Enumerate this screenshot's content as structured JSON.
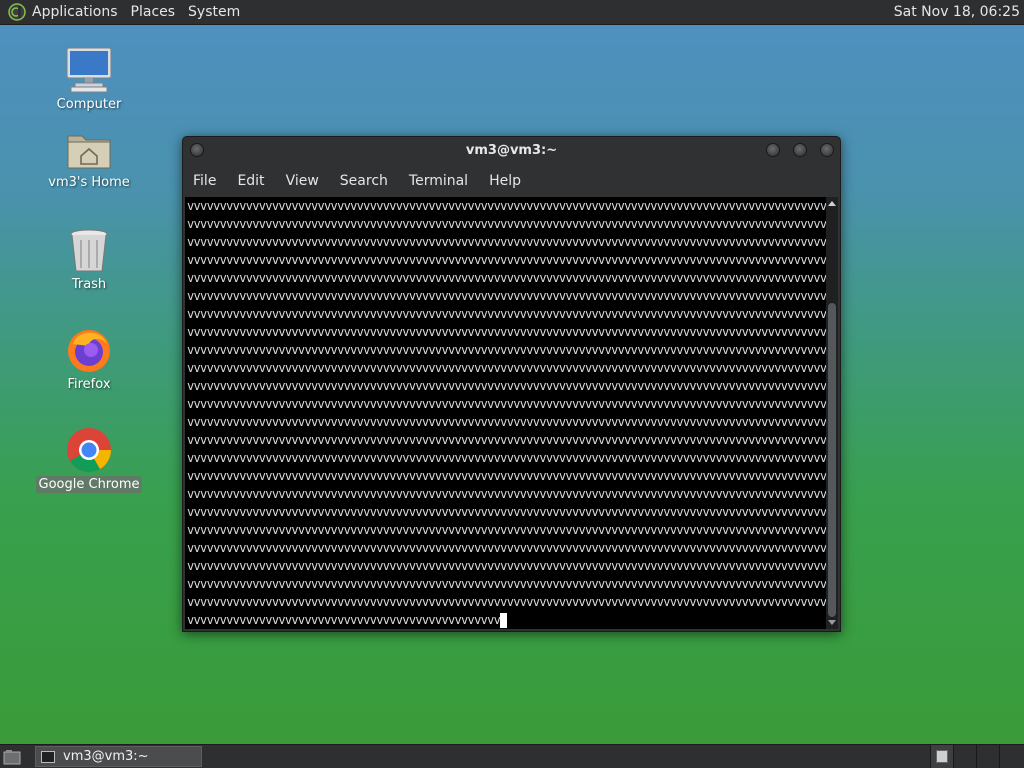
{
  "top_panel": {
    "menu": [
      "Applications",
      "Places",
      "System"
    ],
    "clock": "Sat Nov 18, 06:25"
  },
  "desktop": {
    "icons": [
      {
        "label": "Computer",
        "icon": "computer-icon"
      },
      {
        "label": "vm3's Home",
        "icon": "home-folder-icon"
      },
      {
        "label": "Trash",
        "icon": "trash-icon"
      },
      {
        "label": "Firefox",
        "icon": "firefox-icon"
      },
      {
        "label": "Google Chrome",
        "icon": "chrome-icon",
        "selected": true
      }
    ]
  },
  "terminal": {
    "title": "vm3@vm3:~",
    "menu": [
      "File",
      "Edit",
      "View",
      "Search",
      "Terminal",
      "Help"
    ],
    "lines": [
      "vvvvvvvvvvvvvvvvvvvvvvvvvvvvvvvvvvvvvvvvvvvvvvvvvvvvvvvvvvvvvvvvvvvvvvvvvvvvvvvvvvvvvvvvvvvvvvvvvvvvvv",
      "vvvvvvvvvvvvvvvvvvvvvvvvvvvvvvvvvvvvvvvvvvvvvvvvvvvvvvvvvvvvvvvvvvvvvvvvvvvvvvvvvvvvvvvvvvvvvvvvvvvvvv",
      "vvvvvvvvvvvvvvvvvvvvvvvvvvvvvvvvvvvvvvvvvvvvvvvvvvvvvvvvvvvvvvvvvvvvvvvvvvvvvvvvvvvvvvvvvvvvvvvvvvvvvv",
      "vvvvvvvvvvvvvvvvvvvvvvvvvvvvvvvvvvvvvvvvvvvvvvvvvvvvvvvvvvvvvvvvvvvvvvvvvvvvvvvvvvvvvvvvvvvvvvvvvvvvvv",
      "vvvvvvvvvvvvvvvvvvvvvvvvvvvvvvvvvvvvvvvvvvvvvvvvvvvvvvvvvvvvvvvvvvvvvvvvvvvvvvvvvvvvvvvvvvvvvvvvvvvvvv",
      "vvvvvvvvvvvvvvvvvvvvvvvvvvvvvvvvvvvvvvvvvvvvvvvvvvvvvvvvvvvvvvvvvvvvvvvvvvvvvvvvvvvvvvvvvvvvvvvvvvvvvv",
      "vvvvvvvvvvvvvvvvvvvvvvvvvvvvvvvvvvvvvvvvvvvvvvvvvvvvvvvvvvvvvvvvvvvvvvvvvvvvvvvvvvvvvvvvvvvvvvvvvvvvvv",
      "vvvvvvvvvvvvvvvvvvvvvvvvvvvvvvvvvvvvvvvvvvvvvvvvvvvvvvvvvvvvvvvvvvvvvvvvvvvvvvvvvvvvvvvvvvvvvvvvvvvvvv",
      "vvvvvvvvvvvvvvvvvvvvvvvvvvvvvvvvvvvvvvvvvvvvvvvvvvvvvvvvvvvvvvvvvvvvvvvvvvvvvvvvvvvvvvvvvvvvvvvvvvvvvv",
      "vvvvvvvvvvvvvvvvvvvvvvvvvvvvvvvvvvvvvvvvvvvvvvvvvvvvvvvvvvvvvvvvvvvvvvvvvvvvvvvvvvvvvvvvvvvvvvvvvvvvvv",
      "vvvvvvvvvvvvvvvvvvvvvvvvvvvvvvvvvvvvvvvvvvvvvvvvvvvvvvvvvvvvvvvvvvvvvvvvvvvvvvvvvvvvvvvvvvvvvvvvvvvvvv",
      "vvvvvvvvvvvvvvvvvvvvvvvvvvvvvvvvvvvvvvvvvvvvvvvvvvvvvvvvvvvvvvvvvvvvvvvvvvvvvvvvvvvvvvvvvvvvvvvvvvvvvv",
      "vvvvvvvvvvvvvvvvvvvvvvvvvvvvvvvvvvvvvvvvvvvvvvvvvvvvvvvvvvvvvvvvvvvvvvvvvvvvvvvvvvvvvvvvvvvvvvvvvvvvvv",
      "vvvvvvvvvvvvvvvvvvvvvvvvvvvvvvvvvvvvvvvvvvvvvvvvvvvvvvvvvvvvvvvvvvvvvvvvvvvvvvvvvvvvvvvvvvvvvvvvvvvvvv",
      "vvvvvvvvvvvvvvvvvvvvvvvvvvvvvvvvvvvvvvvvvvvvvvvvvvvvvvvvvvvvvvvvvvvvvvvvvvvvvvvvvvvvvvvvvvvvvvvvvvvvvv",
      "vvvvvvvvvvvvvvvvvvvvvvvvvvvvvvvvvvvvvvvvvvvvvvvvvvvvvvvvvvvvvvvvvvvvvvvvvvvvvvvvvvvvvvvvvvvvvvvvvvvvvv",
      "vvvvvvvvvvvvvvvvvvvvvvvvvvvvvvvvvvvvvvvvvvvvvvvvvvvvvvvvvvvvvvvvvvvvvvvvvvvvvvvvvvvvvvvvvvvvvvvvvvvvvv",
      "vvvvvvvvvvvvvvvvvvvvvvvvvvvvvvvvvvvvvvvvvvvvvvvvvvvvvvvvvvvvvvvvvvvvvvvvvvvvvvvvvvvvvvvvvvvvvvvvvvvvvv",
      "vvvvvvvvvvvvvvvvvvvvvvvvvvvvvvvvvvvvvvvvvvvvvvvvvvvvvvvvvvvvvvvvvvvvvvvvvvvvvvvvvvvvvvvvvvvvvvvvvvvvvv",
      "vvvvvvvvvvvvvvvvvvvvvvvvvvvvvvvvvvvvvvvvvvvvvvvvvvvvvvvvvvvvvvvvvvvvvvvvvvvvvvvvvvvvvvvvvvvvvvvvvvvvvv",
      "vvvvvvvvvvvvvvvvvvvvvvvvvvvvvvvvvvvvvvvvvvvvvvvvvvvvvvvvvvvvvvvvvvvvvvvvvvvvvvvvvvvvvvvvvvvvvvvvvvvvvv",
      "vvvvvvvvvvvvvvvvvvvvvvvvvvvvvvvvvvvvvvvvvvvvvvvvvvvvvvvvvvvvvvvvvvvvvvvvvvvvvvvvvvvvvvvvvvvvvvvvvvvvvv",
      "vvvvvvvvvvvvvvvvvvvvvvvvvvvvvvvvvvvvvvvvvvvvvvvvvvvvvvvvvvvvvvvvvvvvvvvvvvvvvvvvvvvvvvvvvvvvvvvvvvvvvv"
    ],
    "last_line": "vvvvvvvvvvvvvvvvvvvvvvvvvvvvvvvvvvvvvvvvvvvvvvvv",
    "scroll_position": 0.98
  },
  "bottom_panel": {
    "task_label": "vm3@vm3:~",
    "workspaces": 4,
    "active_workspace": 1
  },
  "colors": {
    "panel": "#2e2f30",
    "terminal_bg": "#000000",
    "terminal_fg": "#dcdcdc"
  }
}
